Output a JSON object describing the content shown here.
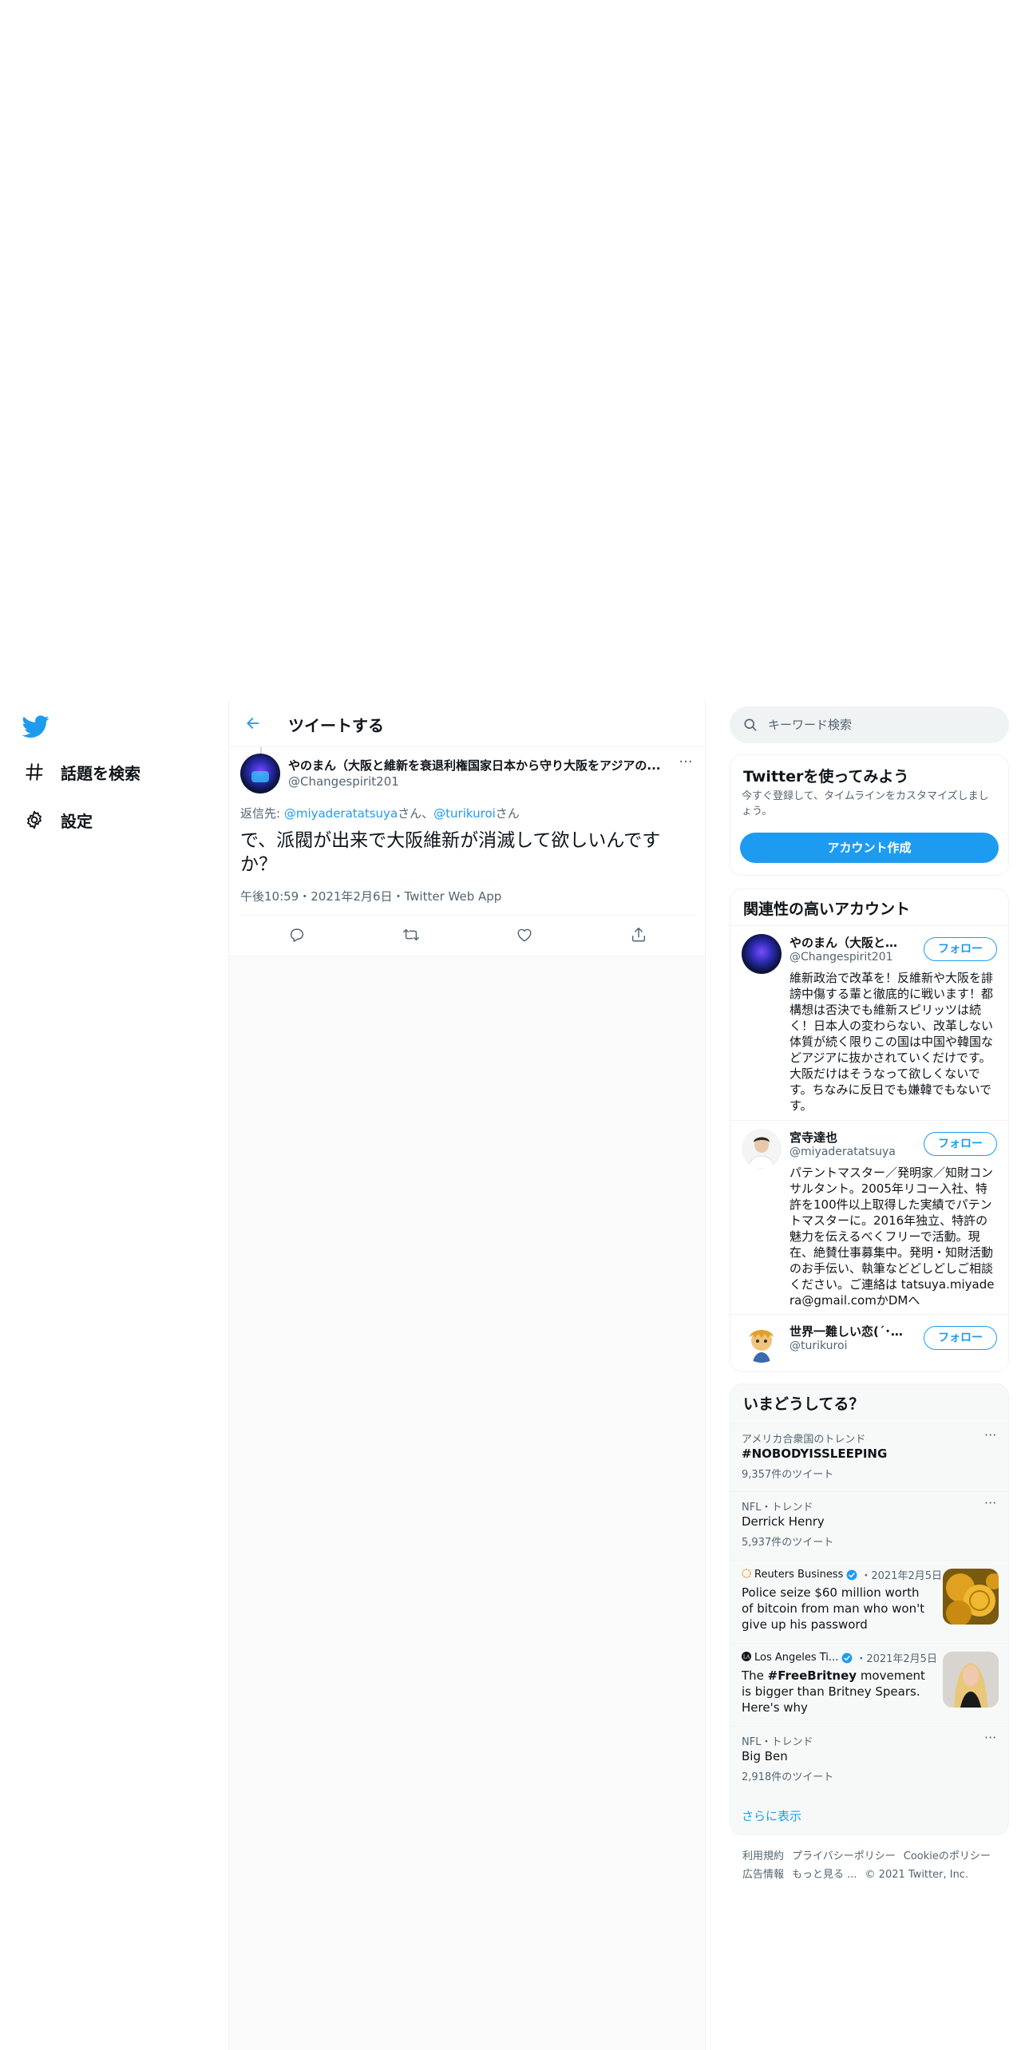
{
  "nav": {
    "explore_label": "話題を検索",
    "settings_label": "設定"
  },
  "header": {
    "title": "ツイートする"
  },
  "tweet": {
    "author_name": "やのまん（大阪と維新を衰退利権国家日本から守り大阪をアジアの...",
    "author_handle": "@Changespirit201",
    "more": "···",
    "reply_prefix": "返信先: ",
    "reply_user1": "@miyaderatatsuya",
    "reply_san1": "さん、",
    "reply_user2": "@turikuroi",
    "reply_san2": "さん",
    "text": "で、派閥が出来で大阪維新が消滅して欲しいんですか？",
    "meta": "午後10:59・2021年2月6日・Twitter Web App"
  },
  "search": {
    "placeholder": "キーワード検索"
  },
  "signup": {
    "title": "Twitterを使ってみよう",
    "description": "今すぐ登録して、タイムラインをカスタマイズしましょう。",
    "button": "アカウント作成"
  },
  "who_to_follow": {
    "title": "関連性の高いアカウント",
    "accounts": [
      {
        "name": "やのまん（大阪と維...",
        "handle": "@Changespirit201",
        "follow": "フォロー",
        "bio": "維新政治で改革を！反維新や大阪を誹謗中傷する輩と徹底的に戦います！都構想は否決でも維新スピリッツは続く！日本人の変わらない、改革しない体質が続く限りこの国は中国や韓国などアジアに抜かされていくだけです。大阪だけはそうなって欲しくないです。ちなみに反日でも嫌韓でもないです。"
      },
      {
        "name": "宮寺達也",
        "handle": "@miyaderatatsuya",
        "follow": "フォロー",
        "bio": "パテントマスター／発明家／知財コンサルタント。2005年リコー入社、特許を100件以上取得した実績でパテントマスターに。2016年独立、特許の魅力を伝えるべくフリーで活動。現在、絶賛仕事募集中。発明・知財活動のお手伝い、執筆などどしどしご相談ください。ご連絡は tatsuya.miyadera@gmail.comかDMへ"
      },
      {
        "name": "世界一難しい恋(´･∀･...",
        "handle": "@turikuroi",
        "follow": "フォロー",
        "bio": ""
      }
    ]
  },
  "trends": {
    "title": "いまどうしてる？",
    "items": [
      {
        "context": "アメリカ合衆国のトレンド",
        "name": "#NOBODYISSLEEPING",
        "count": "9,357件のツイート",
        "more": "···"
      },
      {
        "context": "NFL・トレンド",
        "name": "Derrick Henry",
        "count": "5,937件のツイート",
        "more": "···"
      },
      {
        "context": "NFL・トレンド",
        "name": "Big Ben",
        "count": "2,918件のツイート",
        "more": "···"
      }
    ],
    "news": [
      {
        "source": "Reuters Business",
        "date": "・2021年2月5日",
        "headline": "Police seize $60 million worth of bitcoin from man who won't give up his password"
      },
      {
        "source": "Los Angeles Ti...",
        "date": "・2021年2月5日",
        "headline_pre": "The ",
        "headline_bold": "#FreeBritney",
        "headline_post": " movement is bigger than Britney Spears. Here's why"
      }
    ],
    "show_more": "さらに表示"
  },
  "footer": {
    "terms": "利用規約",
    "privacy": "プライバシーポリシー",
    "cookie": "Cookieのポリシー",
    "ads": "広告情報",
    "more": "もっと見る ...",
    "copyright": "© 2021 Twitter, Inc."
  },
  "colors": {
    "accent": "#1d9bf0",
    "text": "#0f1419",
    "secondary": "#536471"
  }
}
